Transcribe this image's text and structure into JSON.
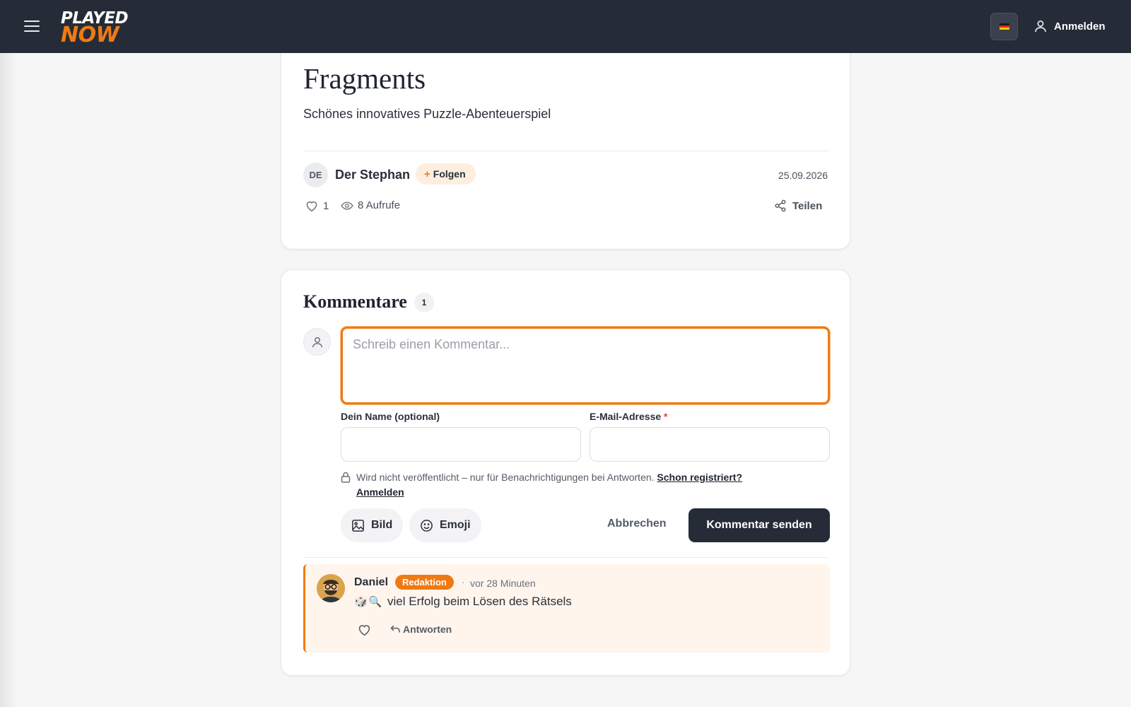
{
  "header": {
    "logo_line1": "PLAYED",
    "logo_line2": "NOW",
    "login_label": "Anmelden",
    "flag_colors": [
      "#1a1a1a",
      "#dd2b1c",
      "#f7c600"
    ]
  },
  "post": {
    "title": "Fragments",
    "subtitle": "Schönes innovatives Puzzle-Abenteuerspiel",
    "author": {
      "initials": "DE",
      "name": "Der Stephan",
      "follow_label": "Folgen"
    },
    "date": "25.09.2026",
    "likes": "1",
    "views": "8 Aufrufe",
    "share_label": "Teilen"
  },
  "comments": {
    "title": "Kommentare",
    "count": "1",
    "form": {
      "placeholder": "Schreib einen Kommentar...",
      "name_label": "Dein Name (optional)",
      "email_label": "E-Mail-Adresse",
      "email_required_mark": "*",
      "privacy_text": "Wird nicht veröffentlicht – nur für Benachrichtigungen bei Antworten.",
      "privacy_link1": "Schon registriert?",
      "privacy_link2": "Anmelden",
      "image_label": "Bild",
      "emoji_label": "Emoji",
      "cancel_label": "Abbrechen",
      "submit_label": "Kommentar senden"
    },
    "items": [
      {
        "author": "Daniel",
        "badge": "Redaktion",
        "separator": "·",
        "time": "vor 28 Minuten",
        "emojis": [
          "🎲",
          "🔍"
        ],
        "text": "viel Erfolg beim Lösen des Rätsels",
        "reply_label": "Antworten"
      }
    ]
  },
  "colors": {
    "accent": "#f07a12",
    "header_bg": "#252c38",
    "page_bg": "#f6f6f7"
  }
}
